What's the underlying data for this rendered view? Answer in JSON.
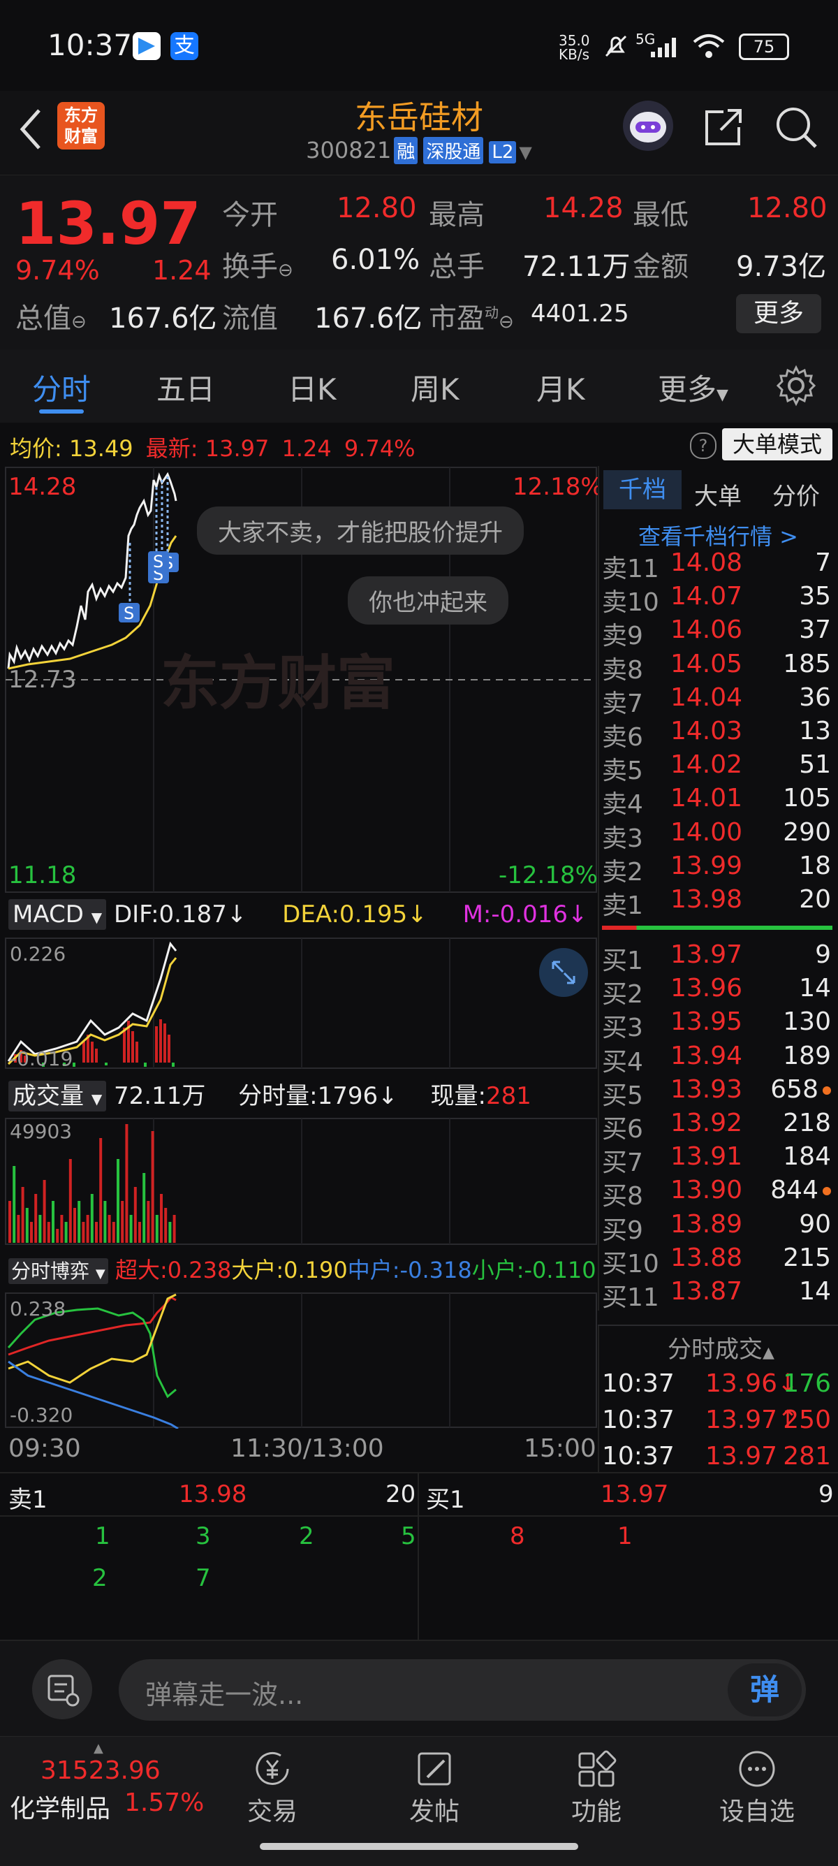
{
  "status": {
    "time": "10:37",
    "net_speed": "35.0\nKB/s",
    "signal": "5G",
    "battery": "75"
  },
  "header": {
    "title": "东岳硅材",
    "code": "300821",
    "badge_rong": "融",
    "badge_sgt": "深股通",
    "badge_l2": "L2",
    "logo": "东方\n财富"
  },
  "quote": {
    "price": "13.97",
    "pct": "9.74%",
    "chg": "1.24",
    "open_label": "今开",
    "open": "12.80",
    "high_label": "最高",
    "high": "14.28",
    "low_label": "最低",
    "low": "12.80",
    "turnover_label": "换手",
    "turnover": "6.01%",
    "volume_label": "总手",
    "volume": "72.11万",
    "amount_label": "金额",
    "amount": "9.73亿",
    "mcap_label": "总值",
    "mcap": "167.6亿",
    "float_label": "流值",
    "float": "167.6亿",
    "pe_label": "市盈",
    "pe_sup": "动",
    "pe": "4401.25",
    "more": "更多"
  },
  "tabs": [
    "分时",
    "五日",
    "日K",
    "周K",
    "月K",
    "更多"
  ],
  "avg_line": {
    "avg_label": "均价:",
    "avg": "13.49",
    "latest_label": "最新:",
    "latest": "13.97",
    "chg": "1.24",
    "pct": "9.74%",
    "mode": "大单模式"
  },
  "chart": {
    "top_price": "14.28",
    "top_pct": "12.18%",
    "mid_price": "12.73",
    "bottom_price": "11.18",
    "bottom_pct": "-12.18%",
    "watermark": "东方财富",
    "bubble1": "大家不卖，才能把股价提升",
    "bubble2": "你也冲起来"
  },
  "macd": {
    "label": "MACD",
    "dif": "DIF:0.187↓",
    "dea": "DEA:0.195↓",
    "m": "M:-0.016↓",
    "top": "0.226",
    "bottom": "-0.019"
  },
  "vol": {
    "label": "成交量",
    "total": "72.11万",
    "tick": "分时量:1796↓",
    "cur_label": "现量:",
    "cur": "281",
    "top": "49903"
  },
  "boyi": {
    "label": "分时博弈",
    "sup": "超大:0.238",
    "big": "大户:0.190",
    "mid": "中户:-0.318",
    "small": "小户:-0.110",
    "top": "0.238",
    "bottom": "-0.320"
  },
  "time_axis": {
    "t1": "09:30",
    "t2": "11:30/13:00",
    "t3": "15:00"
  },
  "orderbook": {
    "tabs": [
      "千档",
      "大单",
      "分价"
    ],
    "link": "查看千档行情 >",
    "sells": [
      [
        "卖11",
        "14.08",
        "7"
      ],
      [
        "卖10",
        "14.07",
        "35"
      ],
      [
        "卖9",
        "14.06",
        "37"
      ],
      [
        "卖8",
        "14.05",
        "185"
      ],
      [
        "卖7",
        "14.04",
        "36"
      ],
      [
        "卖6",
        "14.03",
        "13"
      ],
      [
        "卖5",
        "14.02",
        "51"
      ],
      [
        "卖4",
        "14.01",
        "105"
      ],
      [
        "卖3",
        "14.00",
        "290"
      ],
      [
        "卖2",
        "13.99",
        "18"
      ],
      [
        "卖1",
        "13.98",
        "20"
      ]
    ],
    "buys": [
      [
        "买1",
        "13.97",
        "9"
      ],
      [
        "买2",
        "13.96",
        "14"
      ],
      [
        "买3",
        "13.95",
        "130"
      ],
      [
        "买4",
        "13.94",
        "189"
      ],
      [
        "买5",
        "13.93",
        "658"
      ],
      [
        "买6",
        "13.92",
        "218"
      ],
      [
        "买7",
        "13.91",
        "184"
      ],
      [
        "买8",
        "13.90",
        "844"
      ],
      [
        "买9",
        "13.89",
        "90"
      ],
      [
        "买10",
        "13.88",
        "215"
      ],
      [
        "买11",
        "13.87",
        "14"
      ]
    ],
    "ticks_label": "分时成交",
    "ticks": [
      [
        "10:37",
        "13.96↓",
        "176"
      ],
      [
        "10:37",
        "13.97↑",
        "250"
      ],
      [
        "10:37",
        "13.97",
        "281"
      ]
    ]
  },
  "queue": {
    "sell_label": "卖1",
    "sell_price": "13.98",
    "sell_vol": "20",
    "buy_label": "买1",
    "buy_price": "13.97",
    "buy_vol": "9",
    "sell_q": [
      "1",
      "3",
      "2",
      "5",
      "2",
      "7"
    ],
    "buy_q": [
      "8",
      "1"
    ]
  },
  "danmu": {
    "placeholder": "弹幕走一波...",
    "btn": "弹"
  },
  "nav": {
    "index": "31523.96",
    "sector": "化学制品",
    "sector_pct": "1.57%",
    "items": [
      "交易",
      "发帖",
      "功能",
      "设自选"
    ]
  }
}
